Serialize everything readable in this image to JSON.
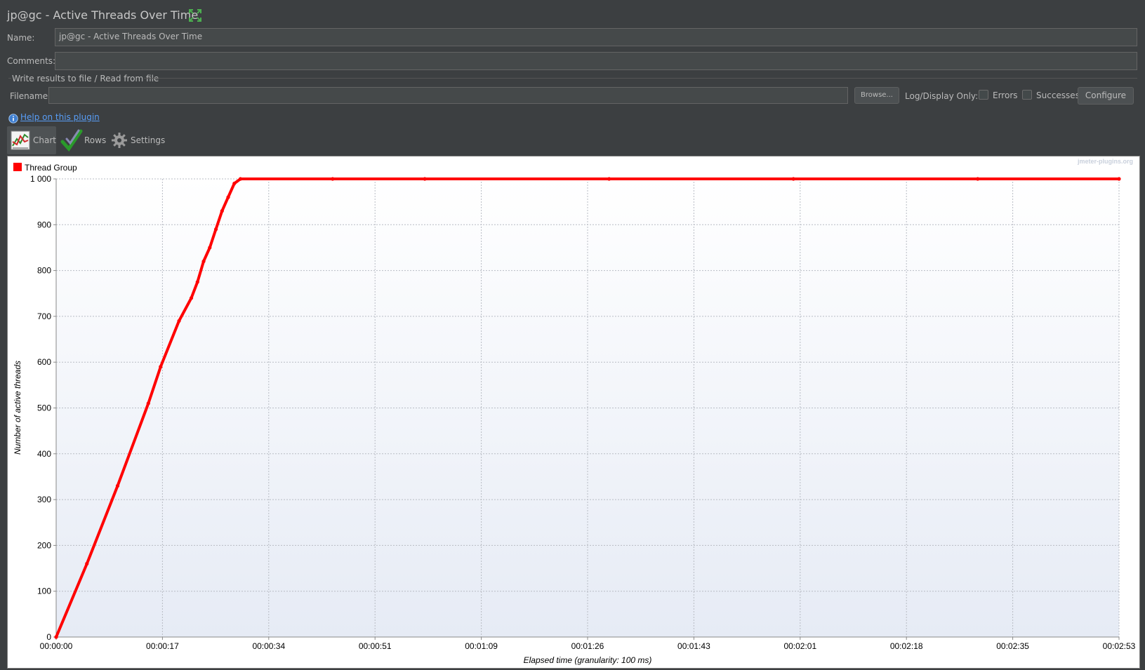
{
  "window": {
    "title": "jp@gc - Active Threads Over Time"
  },
  "form": {
    "name_label": "Name:",
    "name_value": "jp@gc - Active Threads Over Time",
    "comments_label": "Comments:",
    "comments_value": "",
    "file_group_label": "Write results to file / Read from file",
    "filename_label": "Filename",
    "filename_value": "",
    "browse_label": "Browse...",
    "log_display_label": "Log/Display Only:",
    "errors_label": "Errors",
    "successes_label": "Successes",
    "configure_label": "Configure"
  },
  "help": {
    "link_text": "Help on this plugin",
    "icon": "info-icon"
  },
  "tabs": [
    {
      "label": "Chart",
      "icon": "chart-icon",
      "active": true
    },
    {
      "label": "Rows",
      "icon": "checkmark-icon",
      "active": false
    },
    {
      "label": "Settings",
      "icon": "gear-icon",
      "active": false
    }
  ],
  "watermark": "jmeter-plugins.org",
  "colors": {
    "series": "#ff0000",
    "background": "#3c3f41",
    "link": "#589df6"
  },
  "chart_data": {
    "type": "line",
    "title": "",
    "xlabel": "Elapsed time (granularity: 100 ms)",
    "ylabel": "Number of active threads",
    "ylim": [
      0,
      1000
    ],
    "yticks": [
      "0",
      "100",
      "200",
      "300",
      "400",
      "500",
      "600",
      "700",
      "800",
      "900",
      "1 000"
    ],
    "xticks": [
      "00:00:00",
      "00:00:17",
      "00:00:34",
      "00:00:51",
      "00:01:09",
      "00:01:26",
      "00:01:43",
      "00:02:01",
      "00:02:18",
      "00:02:35",
      "00:02:53"
    ],
    "x_unit": "seconds",
    "xlim": [
      0,
      173
    ],
    "grid": true,
    "legend": "top-left",
    "series": [
      {
        "name": "Thread Group",
        "color": "#ff0000",
        "points": [
          [
            0,
            0
          ],
          [
            5,
            160
          ],
          [
            10,
            330
          ],
          [
            15,
            510
          ],
          [
            17,
            590
          ],
          [
            20,
            690
          ],
          [
            22,
            740
          ],
          [
            23,
            775
          ],
          [
            24,
            820
          ],
          [
            25,
            850
          ],
          [
            26,
            890
          ],
          [
            27,
            930
          ],
          [
            28,
            960
          ],
          [
            29,
            990
          ],
          [
            30,
            1000
          ],
          [
            45,
            1000
          ],
          [
            60,
            1000
          ],
          [
            90,
            1000
          ],
          [
            120,
            1000
          ],
          [
            150,
            1000
          ],
          [
            173,
            1000
          ]
        ]
      }
    ]
  }
}
